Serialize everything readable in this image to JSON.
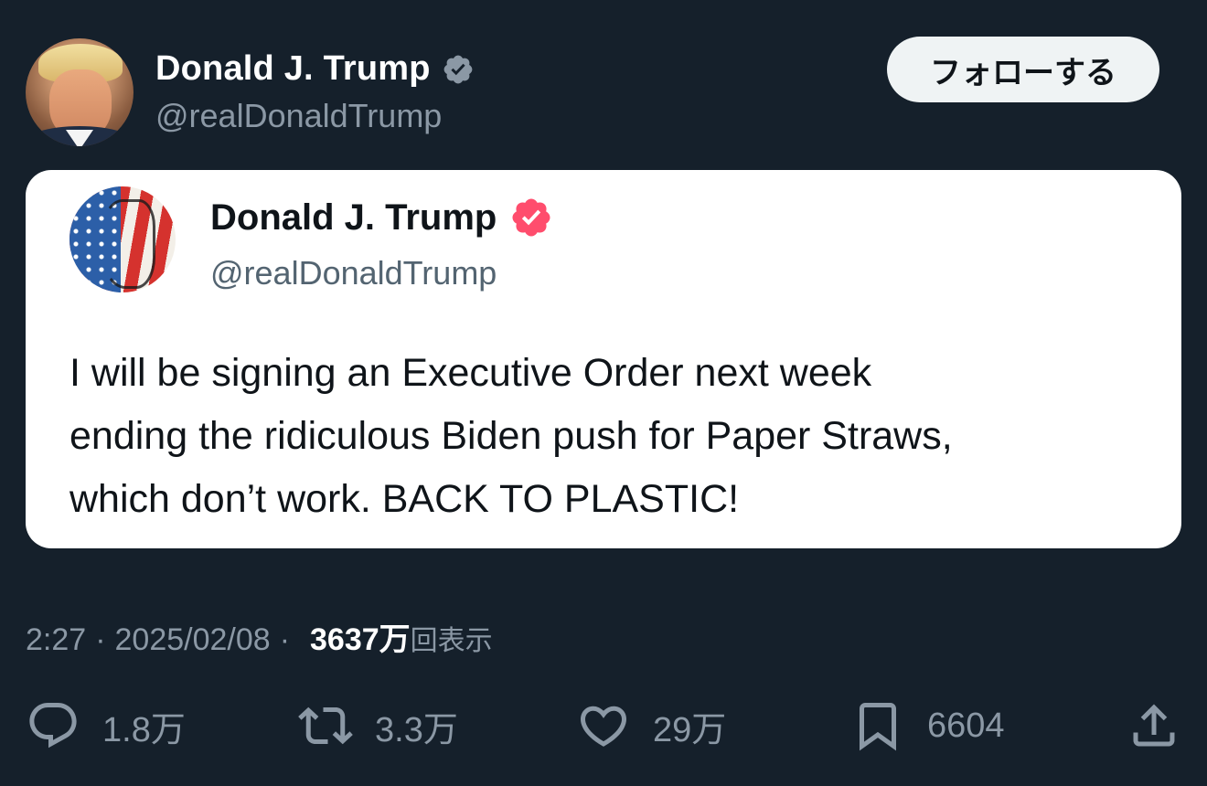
{
  "author": {
    "display_name": "Donald J. Trump",
    "handle": "@realDonaldTrump",
    "verified": true,
    "verified_color": "#8b98a5"
  },
  "follow_button": {
    "label": "フォローする"
  },
  "quoted_post": {
    "display_name": "Donald J. Trump",
    "handle": "@realDonaldTrump",
    "verified_color": "#ff4d6d",
    "text": "I will be signing an Executive Order next week\nending the ridiculous Biden push for Paper Straws,\nwhich don’t work. BACK TO PLASTIC!"
  },
  "meta": {
    "time": "2:27",
    "separator": "·",
    "date": "2025/02/08",
    "views_count": "3637万",
    "views_label": "回表示"
  },
  "actions": {
    "replies": "1.8万",
    "reposts": "3.3万",
    "likes": "29万",
    "bookmarks": "6604"
  },
  "icons": {
    "reply": "reply-icon",
    "repost": "repost-icon",
    "like": "heart-icon",
    "bookmark": "bookmark-icon",
    "share": "share-icon"
  },
  "colors": {
    "background": "#15202b",
    "muted_text": "#8b98a5",
    "card_background": "#ffffff"
  }
}
